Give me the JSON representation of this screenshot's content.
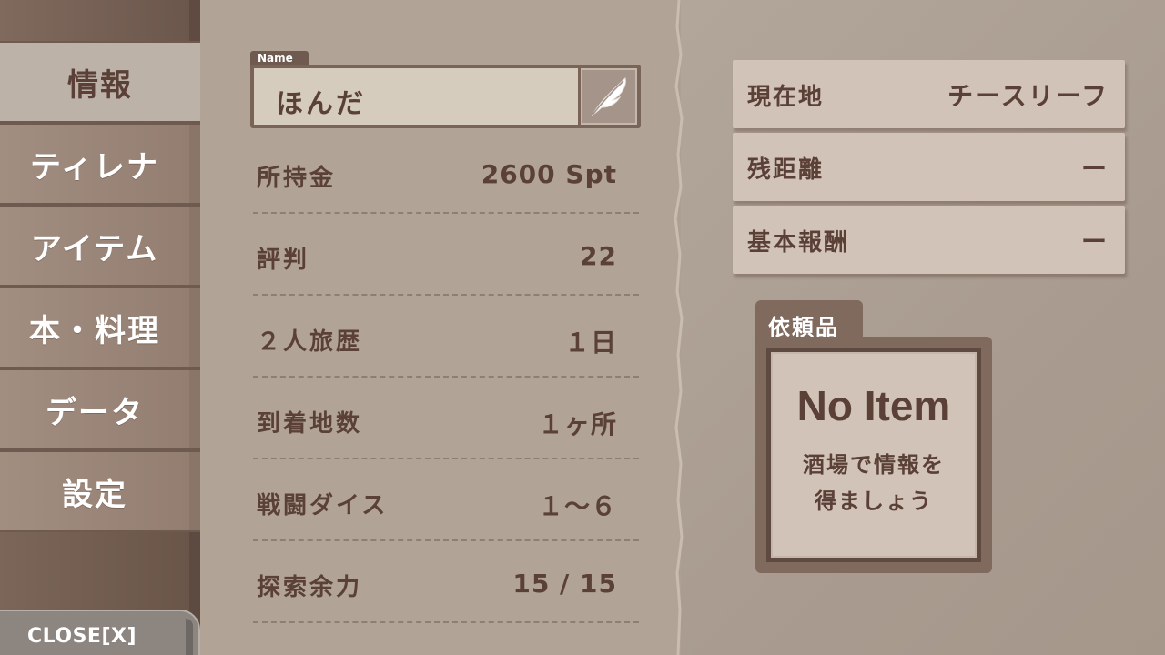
{
  "sidebar": {
    "items": [
      {
        "label": "情報",
        "active": true
      },
      {
        "label": "ティレナ",
        "active": false
      },
      {
        "label": "アイテム",
        "active": false
      },
      {
        "label": "本・料理",
        "active": false
      },
      {
        "label": "データ",
        "active": false
      },
      {
        "label": "設定",
        "active": false
      }
    ],
    "close_label": "CLOSE[X]"
  },
  "name": {
    "tab_label": "Name",
    "value": "ほんだ",
    "edit_icon": "quill-pen-icon"
  },
  "stats": [
    {
      "label": "所持金",
      "value": "2600 Spt"
    },
    {
      "label": "評判",
      "value": "22"
    },
    {
      "label": "２人旅歴",
      "value": "１日"
    },
    {
      "label": "到着地数",
      "value": "１ヶ所"
    },
    {
      "label": "戦闘ダイス",
      "value": "１～６"
    },
    {
      "label": "探索余力",
      "value": "15 / 15"
    }
  ],
  "quest": {
    "cards": [
      {
        "label": "現在地",
        "value": "チースリーフ"
      },
      {
        "label": "残距離",
        "value": "ー"
      },
      {
        "label": "基本報酬",
        "value": "ー"
      }
    ],
    "request_tab": "依頼品",
    "request_title": "No Item",
    "request_hint_line1": "酒場で情報を",
    "request_hint_line2": "得ましょう"
  },
  "colors": {
    "text_dark": "#5a4036",
    "panel": "#b1a396",
    "card": "#d2c3b8",
    "sidebar_active": "#bcb2a8"
  }
}
